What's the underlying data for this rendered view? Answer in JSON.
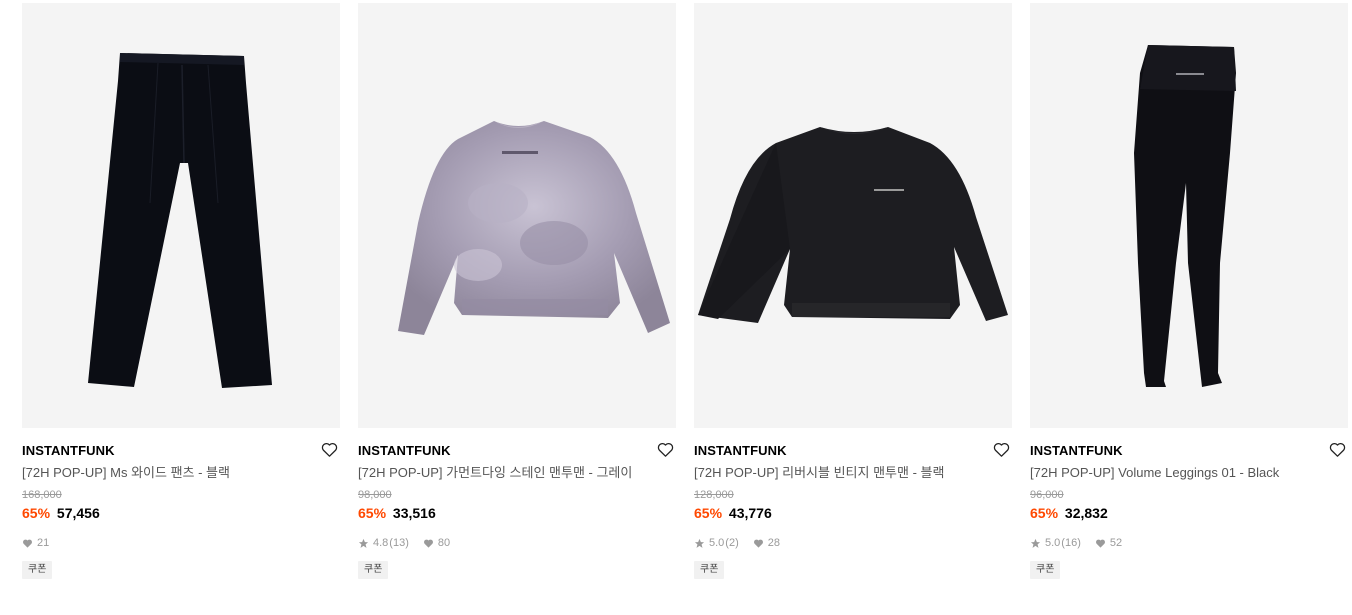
{
  "colors": {
    "discount": "#ff4800",
    "thumb_bg": "#f4f4f4"
  },
  "products": [
    {
      "brand": "INSTANTFUNK",
      "title": "[72H POP-UP] Ms 와이드 팬츠 - 블랙",
      "original_price": "168,000",
      "discount_rate": "65%",
      "price": "57,456",
      "rating": "",
      "reviews": "",
      "likes": "21",
      "badge": "쿠폰",
      "image": "black-wide-pants"
    },
    {
      "brand": "INSTANTFUNK",
      "title": "[72H POP-UP] 가먼트다잉 스테인 맨투맨 - 그레이",
      "original_price": "98,000",
      "discount_rate": "65%",
      "price": "33,516",
      "rating": "4.8",
      "reviews": "(13)",
      "likes": "80",
      "badge": "쿠폰",
      "image": "grey-tie-dye-sweatshirt"
    },
    {
      "brand": "INSTANTFUNK",
      "title": "[72H POP-UP] 리버시블 빈티지 맨투맨 - 블랙",
      "original_price": "128,000",
      "discount_rate": "65%",
      "price": "43,776",
      "rating": "5.0",
      "reviews": "(2)",
      "likes": "28",
      "badge": "쿠폰",
      "image": "black-sweatshirt"
    },
    {
      "brand": "INSTANTFUNK",
      "title": "[72H POP-UP] Volume Leggings 01 - Black",
      "original_price": "96,000",
      "discount_rate": "65%",
      "price": "32,832",
      "rating": "5.0",
      "reviews": "(16)",
      "likes": "52",
      "badge": "쿠폰",
      "image": "black-leggings"
    }
  ]
}
